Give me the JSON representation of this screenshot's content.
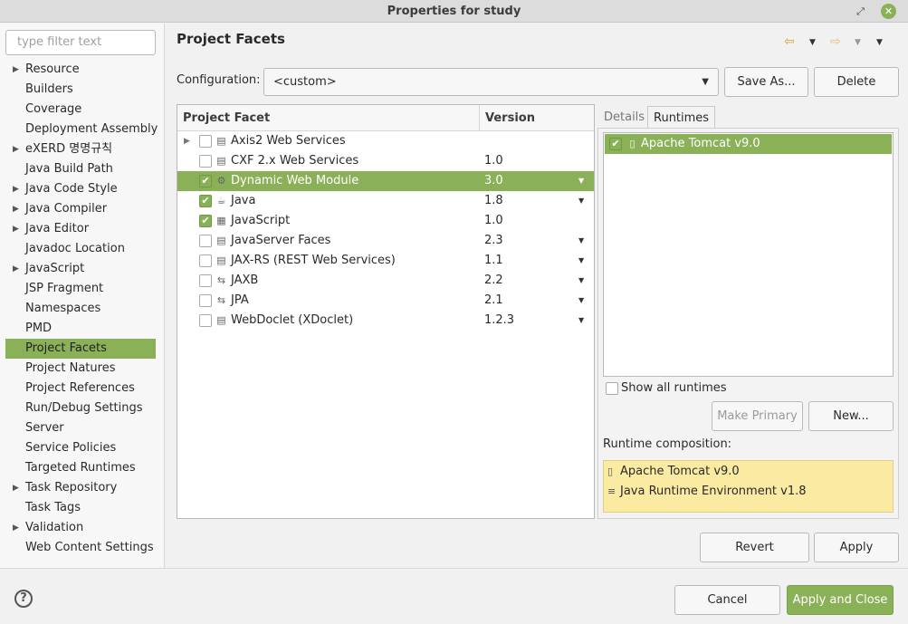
{
  "window": {
    "title": "Properties for study"
  },
  "sidebar": {
    "filter_placeholder": "type filter text",
    "items": [
      {
        "label": "Resource",
        "expandable": true
      },
      {
        "label": "Builders",
        "expandable": false
      },
      {
        "label": "Coverage",
        "expandable": false
      },
      {
        "label": "Deployment Assembly",
        "expandable": false
      },
      {
        "label": "eXERD 명명규칙",
        "expandable": true
      },
      {
        "label": "Java Build Path",
        "expandable": false
      },
      {
        "label": "Java Code Style",
        "expandable": true
      },
      {
        "label": "Java Compiler",
        "expandable": true
      },
      {
        "label": "Java Editor",
        "expandable": true
      },
      {
        "label": "Javadoc Location",
        "expandable": false
      },
      {
        "label": "JavaScript",
        "expandable": true
      },
      {
        "label": "JSP Fragment",
        "expandable": false
      },
      {
        "label": "Namespaces",
        "expandable": false
      },
      {
        "label": "PMD",
        "expandable": false
      },
      {
        "label": "Project Facets",
        "expandable": false,
        "selected": true
      },
      {
        "label": "Project Natures",
        "expandable": false
      },
      {
        "label": "Project References",
        "expandable": false
      },
      {
        "label": "Run/Debug Settings",
        "expandable": false
      },
      {
        "label": "Server",
        "expandable": false
      },
      {
        "label": "Service Policies",
        "expandable": false
      },
      {
        "label": "Targeted Runtimes",
        "expandable": false
      },
      {
        "label": "Task Repository",
        "expandable": true
      },
      {
        "label": "Task Tags",
        "expandable": false
      },
      {
        "label": "Validation",
        "expandable": true
      },
      {
        "label": "Web Content Settings",
        "expandable": false
      }
    ]
  },
  "page": {
    "title": "Project Facets"
  },
  "configuration": {
    "label": "Configuration:",
    "value": "<custom>",
    "save_as": "Save As...",
    "delete": "Delete"
  },
  "facets": {
    "header_facet": "Project Facet",
    "header_version": "Version",
    "rows": [
      {
        "name": "Axis2 Web Services",
        "version": "",
        "checked": false,
        "expandable": true,
        "has_dropdown": false
      },
      {
        "name": "CXF 2.x Web Services",
        "version": "1.0",
        "checked": false,
        "expandable": false,
        "has_dropdown": false
      },
      {
        "name": "Dynamic Web Module",
        "version": "3.0",
        "checked": true,
        "expandable": false,
        "has_dropdown": true,
        "selected": true
      },
      {
        "name": "Java",
        "version": "1.8",
        "checked": true,
        "expandable": false,
        "has_dropdown": true
      },
      {
        "name": "JavaScript",
        "version": "1.0",
        "checked": true,
        "expandable": false,
        "has_dropdown": false
      },
      {
        "name": "JavaServer Faces",
        "version": "2.3",
        "checked": false,
        "expandable": false,
        "has_dropdown": true
      },
      {
        "name": "JAX-RS (REST Web Services)",
        "version": "1.1",
        "checked": false,
        "expandable": false,
        "has_dropdown": true
      },
      {
        "name": "JAXB",
        "version": "2.2",
        "checked": false,
        "expandable": false,
        "has_dropdown": true
      },
      {
        "name": "JPA",
        "version": "2.1",
        "checked": false,
        "expandable": false,
        "has_dropdown": true
      },
      {
        "name": "WebDoclet (XDoclet)",
        "version": "1.2.3",
        "checked": false,
        "expandable": false,
        "has_dropdown": true
      }
    ]
  },
  "runtimes_panel": {
    "tab_details": "Details",
    "tab_runtimes": "Runtimes",
    "runtimes": [
      {
        "name": "Apache Tomcat v9.0",
        "checked": true
      }
    ],
    "show_all_label": "Show all runtimes",
    "make_primary": "Make Primary",
    "new": "New...",
    "composition_label": "Runtime composition:",
    "composition": [
      "Apache Tomcat v9.0",
      "Java Runtime Environment v1.8"
    ]
  },
  "footer": {
    "revert": "Revert",
    "apply": "Apply",
    "cancel": "Cancel",
    "apply_close": "Apply and Close"
  },
  "colors": {
    "accent": "#8bb158",
    "composition_bg": "#fbeaa1"
  }
}
